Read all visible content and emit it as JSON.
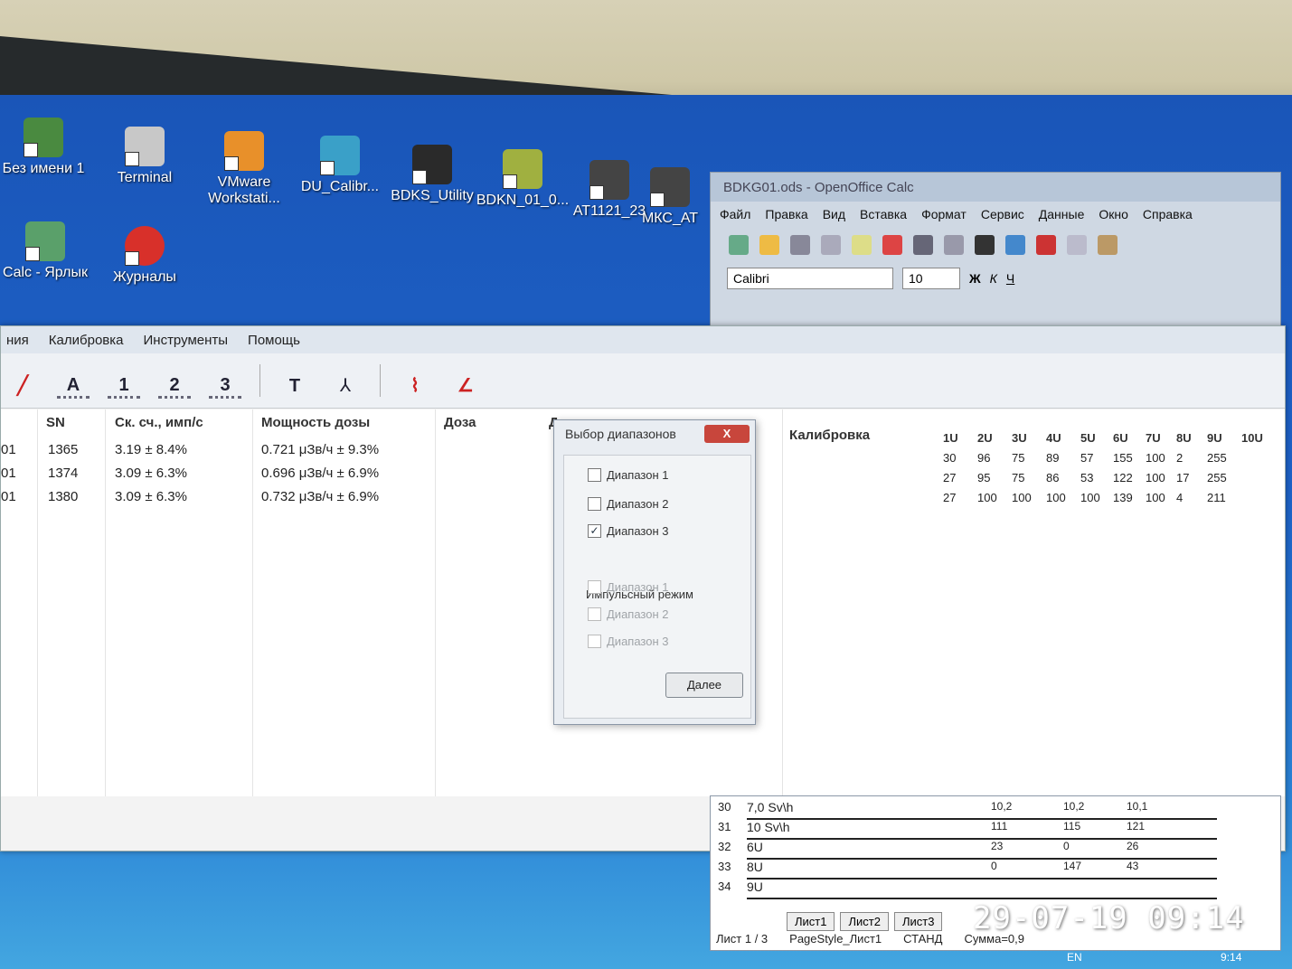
{
  "desktop": {
    "icons": [
      {
        "label": "Без имени 1",
        "color": "#4a8a40"
      },
      {
        "label": "Terminal",
        "color": "#c8c8c8"
      },
      {
        "label": "VMware Workstati...",
        "color": "#e8902a"
      },
      {
        "label": "DU_Calibr...",
        "color": "#3aa0c8"
      },
      {
        "label": "BDKS_Utility",
        "color": "#2a2a2a"
      },
      {
        "label": "BDKN_01_0...",
        "color": "#a0b040"
      },
      {
        "label": "AT1121_23",
        "color": "#444444"
      },
      {
        "label": "МКС_АТ",
        "color": "#444444"
      },
      {
        "label": "Calc - Ярлык",
        "color": "#5aa06a"
      },
      {
        "label": "Журналы",
        "color": "#d8302a"
      }
    ]
  },
  "app": {
    "menu": [
      "ния",
      "Калибровка",
      "Инструменты",
      "Помощь"
    ],
    "toolbar": [
      "A",
      "1",
      "2",
      "3",
      "T",
      "⅄"
    ],
    "columns": {
      "sn": "SN",
      "rate": "Ск. сч., имп/с",
      "power": "Мощность дозы",
      "dose": "Доза",
      "d": "Д",
      "calib": "Калибровка"
    },
    "rows": [
      {
        "id": "01",
        "sn": "1365",
        "rate": "3.19 ± 8.4%",
        "power": "0.721 μЗв/ч ± 9.3%"
      },
      {
        "id": "01",
        "sn": "1374",
        "rate": "3.09 ± 6.3%",
        "power": "0.696 μЗв/ч ± 6.9%"
      },
      {
        "id": "01",
        "sn": "1380",
        "rate": "3.09 ± 6.3%",
        "power": "0.732 μЗв/ч ± 6.9%"
      }
    ],
    "unit_headers": [
      "1U",
      "2U",
      "3U",
      "4U",
      "5U",
      "6U",
      "7U",
      "8U",
      "9U",
      "10U"
    ],
    "unit_rows": [
      [
        "30",
        "96",
        "75",
        "89",
        "57",
        "155",
        "100",
        "2",
        "255",
        ""
      ],
      [
        "27",
        "95",
        "75",
        "86",
        "53",
        "122",
        "100",
        "17",
        "255",
        ""
      ],
      [
        "27",
        "100",
        "100",
        "100",
        "100",
        "139",
        "100",
        "4",
        "211",
        ""
      ]
    ]
  },
  "dialog": {
    "title": "Выбор диапазонов",
    "close": "X",
    "options": [
      {
        "label": "Диапазон 1",
        "checked": false
      },
      {
        "label": "Диапазон 2",
        "checked": false
      },
      {
        "label": "Диапазон 3",
        "checked": true
      }
    ],
    "group_label": "Импульсный режим",
    "pulse_options": [
      {
        "label": "Диапазон 1",
        "checked": false
      },
      {
        "label": "Диапазон 2",
        "checked": false
      },
      {
        "label": "Диапазон 3",
        "checked": false
      }
    ],
    "next": "Далее"
  },
  "openoffice": {
    "title": "BDKG01.ods - OpenOffice Calc",
    "menu": [
      "Файл",
      "Правка",
      "Вид",
      "Вставка",
      "Формат",
      "Сервис",
      "Данные",
      "Окно",
      "Справка"
    ],
    "font": "Calibri",
    "size": "10",
    "format_buttons": [
      "Ж",
      "К",
      "Ч"
    ],
    "rows": [
      {
        "num": "30",
        "label": "7,0 Sv\\h",
        "v1": "10,2",
        "v2": "10,2",
        "v3": "10,1"
      },
      {
        "num": "31",
        "label": "10 Sv\\h",
        "v1": "111",
        "v2": "115",
        "v3": "121"
      },
      {
        "num": "32",
        "label": "6U",
        "v1": "23",
        "v2": "0",
        "v3": "26"
      },
      {
        "num": "33",
        "label": "8U",
        "v1": "0",
        "v2": "147",
        "v3": "43"
      },
      {
        "num": "34",
        "label": "9U",
        "v1": "",
        "v2": "",
        "v3": ""
      }
    ],
    "tabs": [
      "Лист1",
      "Лист2",
      "Лист3"
    ],
    "status_sheet": "Лист 1 / 3",
    "status_style": "PageStyle_Лист1",
    "status_mode": "СТАНД",
    "status_sum": "Сумма=0,9"
  },
  "timestamp": "29-07-19 09:14",
  "taskbar": {
    "lang": "EN",
    "clock": "9:14"
  }
}
